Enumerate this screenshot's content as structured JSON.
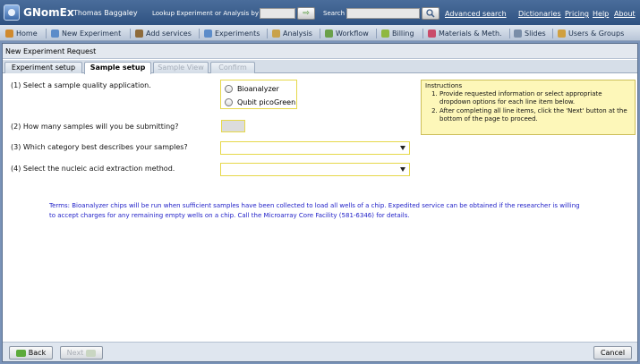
{
  "header": {
    "app_name": "GNomEx",
    "user": "Thomas Baggaley",
    "lookup_label": "Lookup Experiment or Analysis by #",
    "go_label": "⇨",
    "search_label": "Search",
    "advanced_search": "Advanced search",
    "links": [
      "Dictionaries",
      "Pricing",
      "Help",
      "About"
    ]
  },
  "nav": {
    "items": [
      {
        "label": "Home",
        "icon": "home-icon"
      },
      {
        "label": "New Experiment",
        "icon": "flask-icon"
      },
      {
        "label": "Add services",
        "icon": "tools-icon"
      },
      {
        "label": "Experiments",
        "icon": "flask-icon"
      },
      {
        "label": "Analysis",
        "icon": "chart-icon"
      },
      {
        "label": "Workflow",
        "icon": "workflow-icon"
      },
      {
        "label": "Billing",
        "icon": "billing-icon"
      },
      {
        "label": "Materials & Meth.",
        "icon": "materials-icon"
      },
      {
        "label": "Slides",
        "icon": "slides-icon"
      },
      {
        "label": "Users & Groups",
        "icon": "users-icon"
      }
    ]
  },
  "panel": {
    "title": "New Experiment Request",
    "tabs": [
      {
        "label": "Experiment setup",
        "state": "normal"
      },
      {
        "label": "Sample setup",
        "state": "active"
      },
      {
        "label": "Sample View",
        "state": "disabled"
      },
      {
        "label": "Confirm",
        "state": "disabled"
      }
    ]
  },
  "form": {
    "q1": "(1) Select a sample quality application.",
    "q1_options": [
      "Bioanalyzer",
      "Qubit picoGreen"
    ],
    "q2": "(2) How many samples will you be submitting?",
    "q2_value": "",
    "q3": "(3) Which category best describes your samples?",
    "q3_value": "",
    "q4": "(4) Select the nucleic acid extraction method.",
    "q4_value": ""
  },
  "instructions": {
    "title": "Instructions",
    "items": [
      "Provide requested information or select appropriate dropdown options for each line item below.",
      "After completing all line items, click the 'Next' button at the bottom of the page to proceed."
    ]
  },
  "terms": "Terms:  Bioanalyzer chips will be run when sufficient samples have been collected to load all wells of a chip.  Expedited service can be obtained if the researcher is willing to accept charges for any remaining empty wells on a chip.  Call the Microarray Core Facility (581-6346) for details.",
  "footer": {
    "back": "Back",
    "next": "Next",
    "cancel": "Cancel"
  },
  "colors": {
    "header_bg": "#2f5281",
    "nav_bg": "#c9d4e2",
    "field_border": "#e6d84a",
    "instructions_bg": "#fdf7b9",
    "terms_text": "#2222c8"
  }
}
